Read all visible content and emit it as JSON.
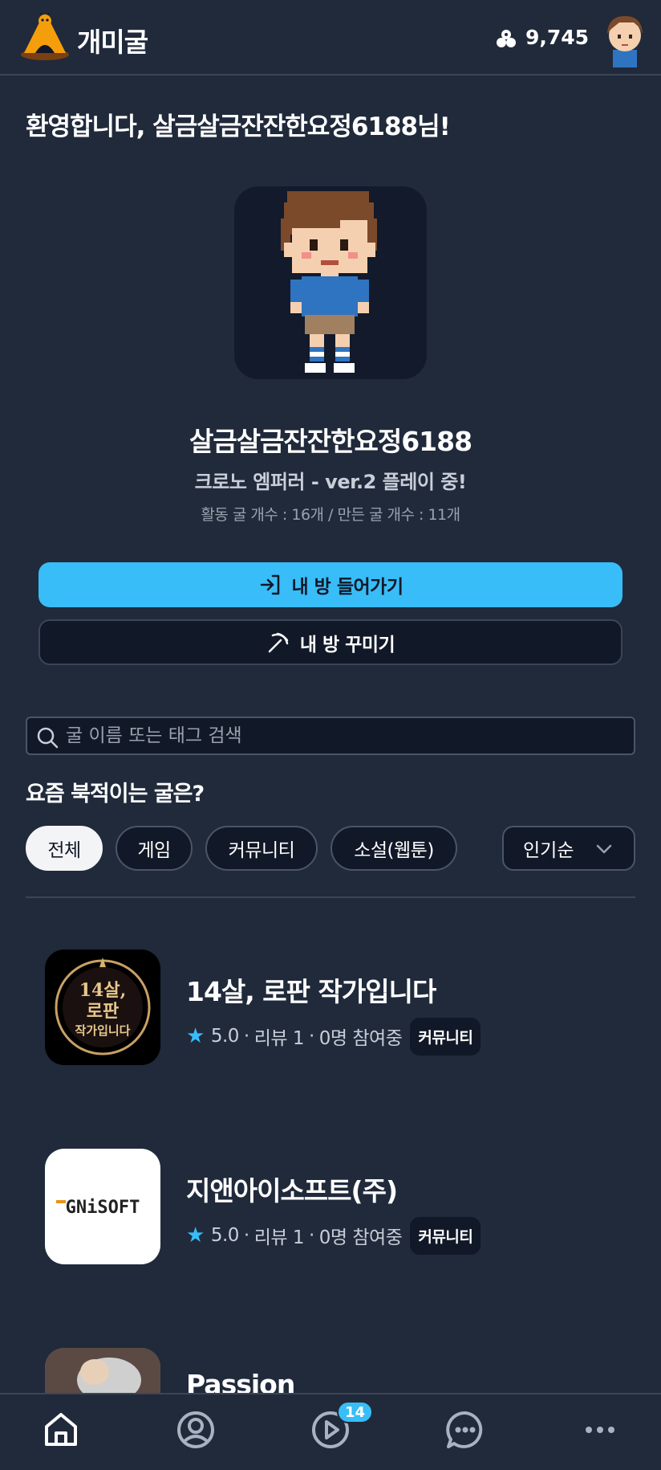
{
  "header": {
    "app_title": "개미굴",
    "coin_count": "9,745",
    "icons": {
      "logo": "ant-hill-logo",
      "coin": "coin-cluster-icon",
      "avatar": "user-avatar"
    }
  },
  "welcome": "환영합니다, 살금살금잔잔한요정6188님!",
  "profile": {
    "username": "살금살금잔잔한요정6188",
    "playing": "크로노 엠퍼러 - ver.2 플레이 중!",
    "stats": "활동 굴 개수 : 16개 / 만든 굴 개수 : 11개"
  },
  "actions": {
    "enter_room": "내 방 들어가기",
    "decorate_room": "내 방 꾸미기"
  },
  "search": {
    "placeholder": "굴 이름 또는 태그 검색",
    "value": ""
  },
  "section_title": "요즘 북적이는 굴은?",
  "filters": [
    "전체",
    "게임",
    "커뮤니티",
    "소설(웹툰)"
  ],
  "active_filter": "전체",
  "sort": {
    "selected": "인기순"
  },
  "rooms": [
    {
      "title": "14살, 로판 작가입니다",
      "rating": "5.0",
      "reviews": "리뷰 1",
      "participants": "0명 참여중",
      "tag": "커뮤니티",
      "thumb_text": [
        "14살,",
        "로판",
        "작가입니다"
      ]
    },
    {
      "title": "지앤아이소프트(주)",
      "rating": "5.0",
      "reviews": "리뷰 1",
      "participants": "0명 참여중",
      "tag": "커뮤니티",
      "thumb_text": [
        "GNiSOFT"
      ]
    },
    {
      "title": "Passion"
    }
  ],
  "bottom_nav": {
    "items": [
      "home-icon",
      "profile-icon",
      "play-icon",
      "chat-icon",
      "more-icon"
    ],
    "badge": "14"
  },
  "colors": {
    "accent": "#38bdf8",
    "background": "#202a3b",
    "surface": "#111827"
  }
}
